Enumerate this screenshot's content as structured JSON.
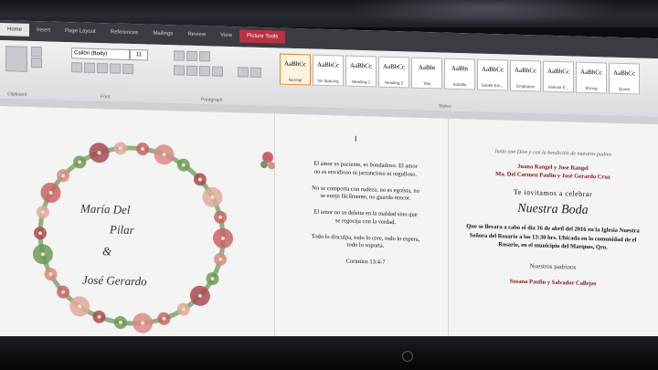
{
  "ribbon": {
    "tabs": [
      {
        "label": "Home",
        "active": true
      },
      {
        "label": "Insert"
      },
      {
        "label": "Page Layout"
      },
      {
        "label": "References"
      },
      {
        "label": "Mailings"
      },
      {
        "label": "Review"
      },
      {
        "label": "View"
      },
      {
        "label": "Picture Tools"
      }
    ],
    "font_name": "Calibri (Body)",
    "font_size": "11",
    "group_labels": [
      "Clipboard",
      "Font",
      "Paragraph",
      "Styles"
    ],
    "styles": [
      {
        "preview": "AaBbCc",
        "name": "Normal",
        "selected": true
      },
      {
        "preview": "AaBbCc",
        "name": "No Spacing"
      },
      {
        "preview": "AaBbCc",
        "name": "Heading 1"
      },
      {
        "preview": "AaBbCc",
        "name": "Heading 2"
      },
      {
        "preview": "AaBbt",
        "name": "Title"
      },
      {
        "preview": "AaBbt",
        "name": "Subtitle"
      },
      {
        "preview": "AaBbCc",
        "name": "Subtle Em..."
      },
      {
        "preview": "AaBbCc",
        "name": "Emphasis"
      },
      {
        "preview": "AaBbCc",
        "name": "Intense E..."
      },
      {
        "preview": "AaBbCc",
        "name": "Strong"
      },
      {
        "preview": "AaBbCc",
        "name": "Quote"
      }
    ]
  },
  "invitation": {
    "bride": "María Del",
    "bride2": "Pilar",
    "amp": "&",
    "groom": "José Gerardo",
    "poem": [
      "El amor es paciente, es bondadoso. El amor no es envidioso ni jactancioso ni orgulloso.",
      "No se comporta con rudeza, no es egoísta, no se enoja fácilmente, no guarda rencor.",
      "El amor no se deleita en la maldad sino que se regocija con la verdad.",
      "Todo lo disculpa, todo lo cree, todo lo espera, todo lo soporta.",
      "Corintios 13:4-7"
    ],
    "blessing": "Junto con Dios y con la bendición de nuestros padres",
    "parents_bride": "Juana Rangel y Jose Rangel",
    "parents_groom": "Ma. Del Carmen Paulin y José Gerardo Cruz",
    "invite": "Te invitamos a celebrar",
    "event": "Nuestra Boda",
    "details": "Que se llevara a cabo el día 16 de abril del 2016 en la Iglesia Nuestra Señora del Rosario a las 13:30 hrs. Ubicada en la comunidad de el Rosario, en el municipio del Marques, Qro.",
    "godparents_title": "Nuestros padrinos",
    "godparents": "Susana Paulin y Salvador Callejas"
  },
  "colors": {
    "accent_red": "#b83245",
    "flower_pink": "#c9646a",
    "leaf_green": "#6f9a5a",
    "text_maroon": "#7a1620"
  }
}
